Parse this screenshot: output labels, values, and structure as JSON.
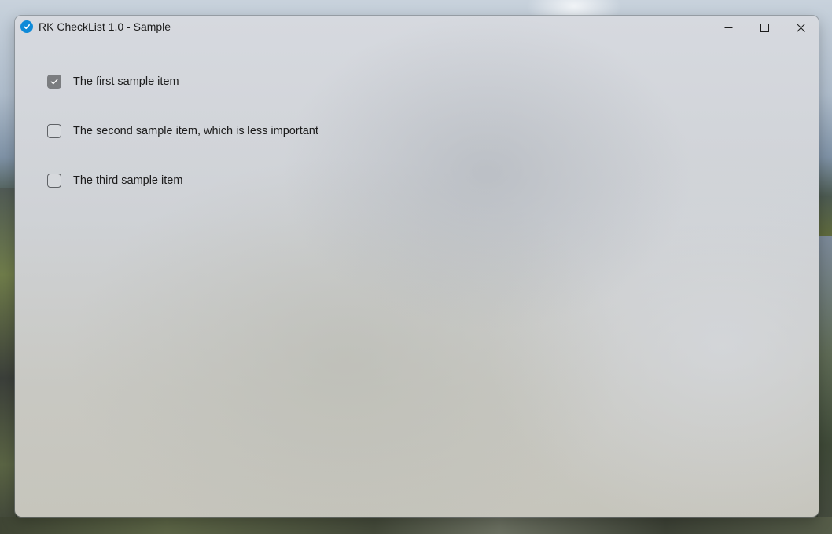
{
  "window": {
    "title": "RK CheckList 1.0 - Sample",
    "app_icon": "check-circle-icon",
    "accent_color": "#0f8ad8",
    "controls": {
      "minimize_icon": "minimize-icon",
      "maximize_icon": "maximize-icon",
      "close_icon": "close-icon"
    }
  },
  "checklist": {
    "items": [
      {
        "label": "The first sample item",
        "checked": true
      },
      {
        "label": "The second sample item, which is less important",
        "checked": false
      },
      {
        "label": "The third sample item",
        "checked": false
      }
    ]
  }
}
